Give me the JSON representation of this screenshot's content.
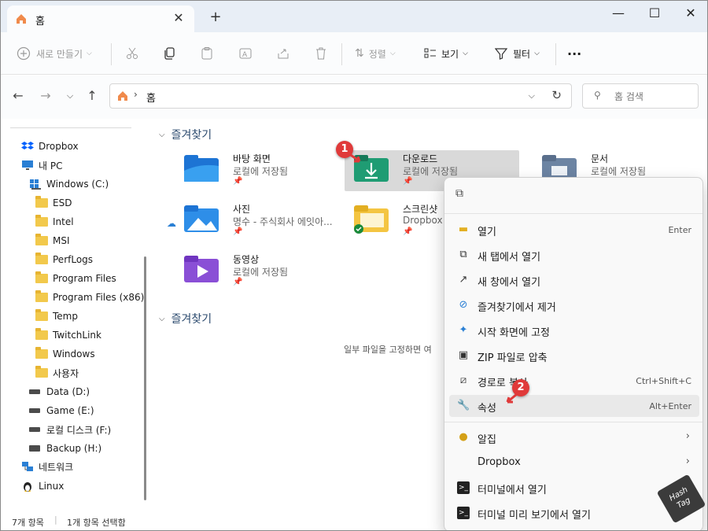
{
  "tab": {
    "title": "홈",
    "close": "✕",
    "new_tab": "+"
  },
  "window_controls": {
    "minimize": "—",
    "maximize": "☐",
    "close": "✕"
  },
  "toolbar": {
    "new_label": "새로 만들기",
    "sort_label": "정렬",
    "view_label": "보기",
    "filter_label": "필터",
    "more_label": "···"
  },
  "address": {
    "crumb": "홈",
    "search_placeholder": "홈 검색"
  },
  "sidebar": {
    "dropbox": "Dropbox",
    "this_pc": "내 PC",
    "windows_c": "Windows (C:)",
    "folders": [
      "ESD",
      "Intel",
      "MSI",
      "PerfLogs",
      "Program Files",
      "Program Files (x86)",
      "Temp",
      "TwitchLink",
      "Windows",
      "사용자"
    ],
    "data_d": "Data (D:)",
    "game_e": "Game (E:)",
    "local_f": "로컬 디스크 (F:)",
    "backup_h": "Backup (H:)",
    "network": "네트워크",
    "linux": "Linux"
  },
  "content": {
    "section1": "즐겨찾기",
    "section2": "즐겨찾기",
    "tiles": [
      {
        "name": "바탕 화면",
        "sub": "로컬에 저장됨"
      },
      {
        "name": "다운로드",
        "sub": "로컬에 저장됨"
      },
      {
        "name": "문서",
        "sub": "로컬에 저장됨"
      },
      {
        "name": "사진",
        "sub": "명수 - 주식회사 에잇아..."
      },
      {
        "name": "스크린샷",
        "sub": "Dropbox"
      },
      {
        "name": "동영상",
        "sub": "로컬에 저장됨"
      }
    ],
    "empty_msg": "일부 파일을 고정하면 여"
  },
  "status": {
    "item_count": "7개 항목",
    "selected": "1개 항목 선택함"
  },
  "context_menu": {
    "items": [
      {
        "label": "열기",
        "key": "Enter"
      },
      {
        "label": "새 탭에서 열기",
        "key": ""
      },
      {
        "label": "새 창에서 열기",
        "key": ""
      },
      {
        "label": "즐겨찾기에서 제거",
        "key": ""
      },
      {
        "label": "시작 화면에 고정",
        "key": ""
      },
      {
        "label": "ZIP 파일로 압축",
        "key": ""
      },
      {
        "label": "경로로 복사",
        "key": "Ctrl+Shift+C"
      },
      {
        "label": "속성",
        "key": "Alt+Enter"
      },
      {
        "label": "알집",
        "key": ""
      },
      {
        "label": "Dropbox",
        "key": ""
      },
      {
        "label": "터미널에서 열기",
        "key": ""
      },
      {
        "label": "터미널 미리 보기에서 열기",
        "key": ""
      }
    ]
  },
  "badges": {
    "one": "1",
    "two": "2"
  },
  "watermark": {
    "line1": "Hash",
    "line2": "Tag"
  },
  "colors": {
    "accent": "#0f6cbd",
    "selected_tile": "#d9d9d9",
    "badge": "#e03a3a",
    "download_green": "#1f9c73"
  }
}
